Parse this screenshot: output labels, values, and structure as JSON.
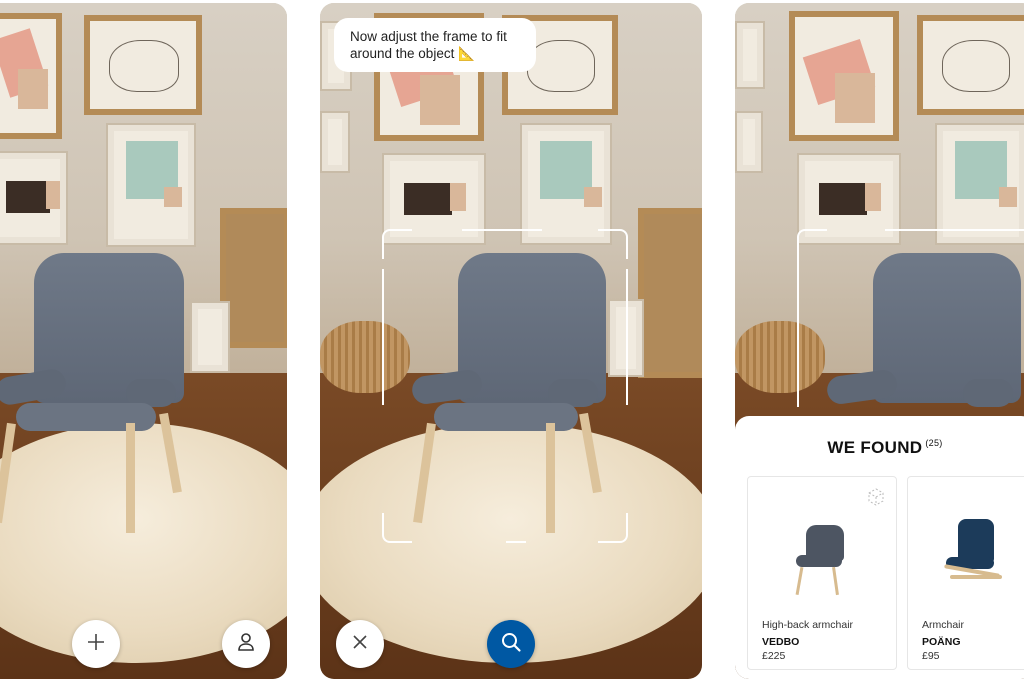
{
  "screen2": {
    "hint": "Now adjust the frame to fit around the object 📐"
  },
  "results": {
    "heading": "WE FOUND",
    "count": "(25)",
    "products": [
      {
        "description": "High-back armchair",
        "name": "VEDBO",
        "price": "£225"
      },
      {
        "description": "Armchair",
        "name": "POÄNG",
        "price": "£95"
      }
    ]
  },
  "colors": {
    "accent_blue": "#0058a3",
    "chair_gray": "#6b7482"
  },
  "icons": [
    "plus-icon",
    "person-icon",
    "close-icon",
    "search-icon",
    "ar-cube-icon"
  ]
}
